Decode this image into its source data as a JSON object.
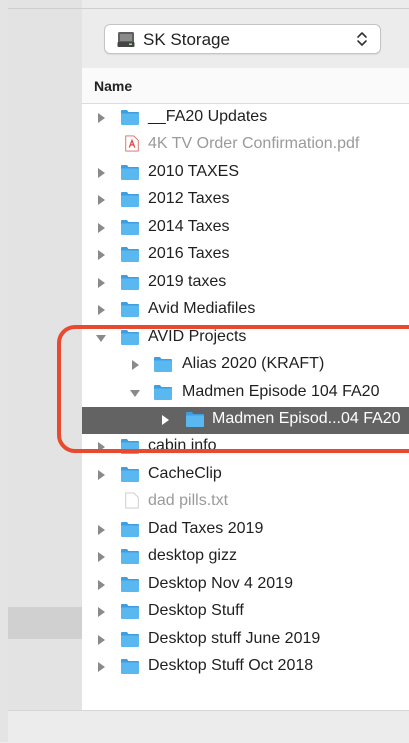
{
  "location": {
    "volume_name": "SK Storage"
  },
  "list": {
    "column_name": "Name",
    "rows": [
      {
        "name": "__FA20 Updates",
        "kind": "folder",
        "state": "collapsed"
      },
      {
        "name": "4K TV Order Confirmation.pdf",
        "kind": "pdf"
      },
      {
        "name": "2010 TAXES",
        "kind": "folder",
        "state": "collapsed"
      },
      {
        "name": "2012 Taxes",
        "kind": "folder",
        "state": "collapsed"
      },
      {
        "name": "2014 Taxes",
        "kind": "folder",
        "state": "collapsed"
      },
      {
        "name": "2016 Taxes",
        "kind": "folder",
        "state": "collapsed"
      },
      {
        "name": "2019 taxes",
        "kind": "folder",
        "state": "collapsed"
      },
      {
        "name": "Avid Mediafiles",
        "kind": "folder",
        "state": "collapsed"
      },
      {
        "name": "AVID Projects",
        "kind": "folder",
        "state": "expanded"
      },
      {
        "name": "Alias 2020 (KRAFT)",
        "kind": "folder",
        "state": "collapsed"
      },
      {
        "name": "Madmen Episode 104 FA20",
        "kind": "folder",
        "state": "expanded"
      },
      {
        "name": "Madmen Episod...04 FA20",
        "kind": "folder",
        "state": "collapsed",
        "selected": true
      },
      {
        "name": "cabin info",
        "kind": "folder",
        "state": "collapsed"
      },
      {
        "name": "CacheClip",
        "kind": "folder",
        "state": "collapsed"
      },
      {
        "name": "dad pills.txt",
        "kind": "text"
      },
      {
        "name": "Dad Taxes 2019",
        "kind": "folder",
        "state": "collapsed"
      },
      {
        "name": "desktop gizz",
        "kind": "folder",
        "state": "collapsed"
      },
      {
        "name": "Desktop Nov 4 2019",
        "kind": "folder",
        "state": "collapsed"
      },
      {
        "name": "Desktop Stuff",
        "kind": "folder",
        "state": "collapsed"
      },
      {
        "name": "Desktop stuff June 2019",
        "kind": "folder",
        "state": "collapsed"
      },
      {
        "name": "Desktop Stuff Oct 2018",
        "kind": "folder",
        "state": "collapsed"
      }
    ]
  },
  "colors": {
    "folder": "#5ab8f0",
    "selection": "#636363",
    "annotation": "#e8492f",
    "pdf_icon": "#e0463c"
  }
}
